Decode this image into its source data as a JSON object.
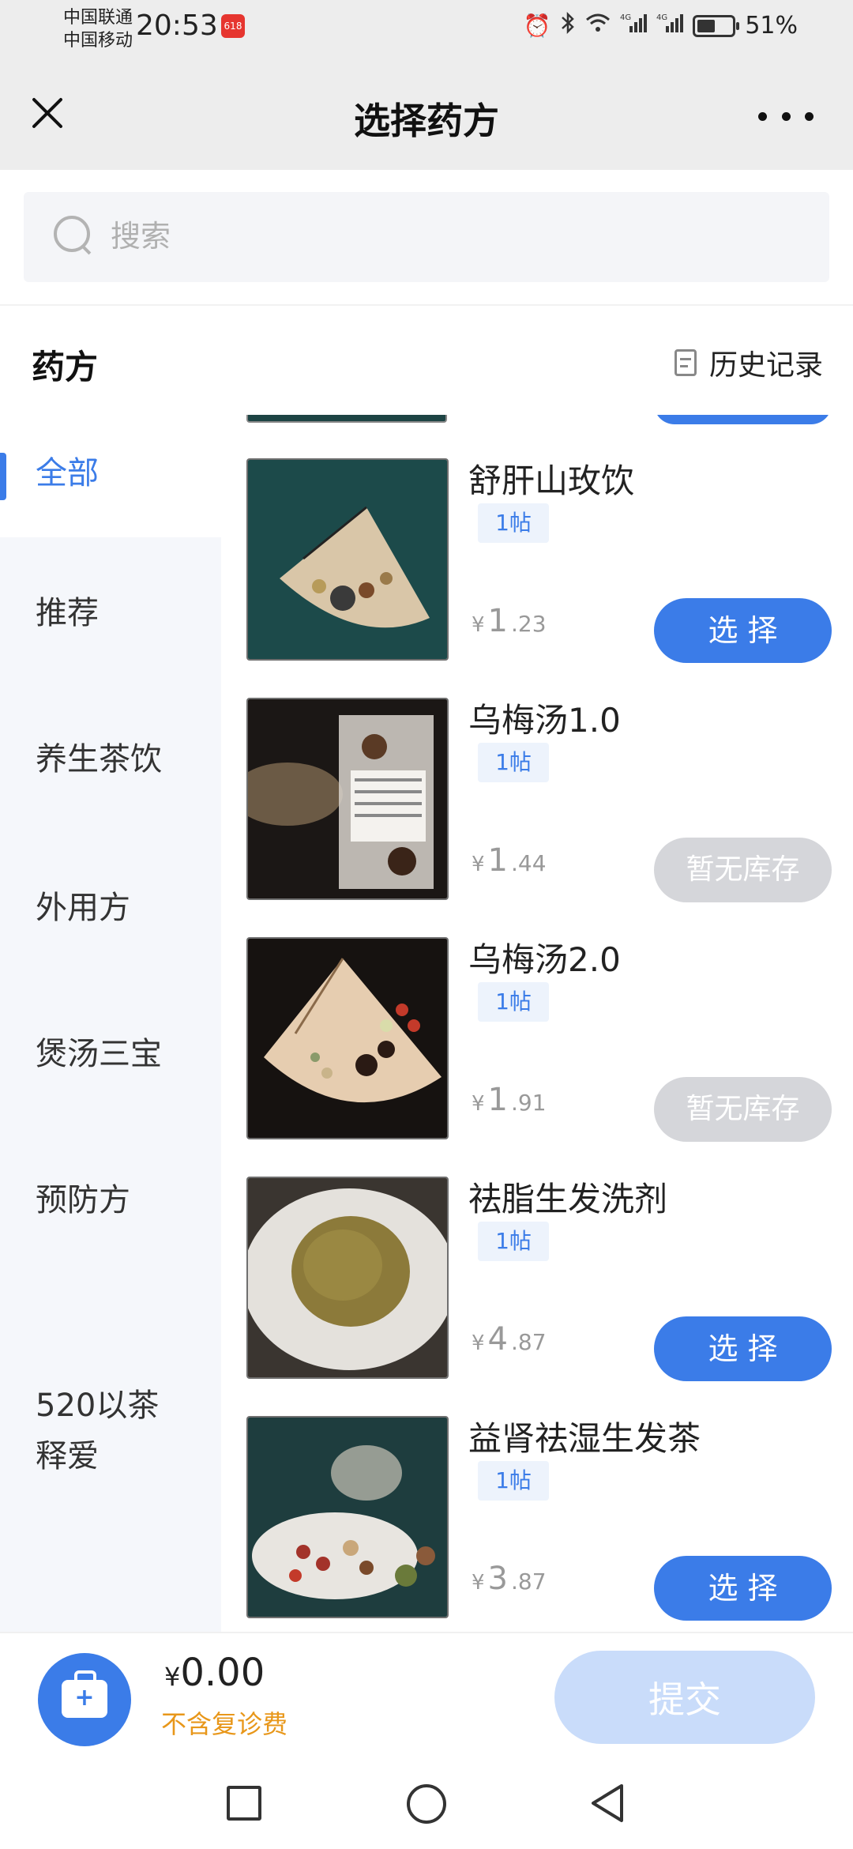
{
  "status_bar": {
    "carrier1": "中国联通",
    "carrier2": "中国移动",
    "time": "20:53",
    "badge": "618",
    "battery_percent": "51%",
    "battery_level": 0.51,
    "icons": [
      "alarm-icon",
      "bluetooth-icon",
      "wifi-icon",
      "signal-4g-icon",
      "signal-4g-icon",
      "battery-icon"
    ]
  },
  "nav": {
    "title": "选择药方"
  },
  "search": {
    "placeholder": "搜索"
  },
  "section": {
    "title": "药方",
    "history_label": "历史记录"
  },
  "sidebar": {
    "items": [
      {
        "label": "全部",
        "active": true
      },
      {
        "label": "推荐"
      },
      {
        "label": "养生茶饮"
      },
      {
        "label": "外用方"
      },
      {
        "label": "煲汤三宝"
      },
      {
        "label": "预防方"
      },
      {
        "label": "520以茶\n释爱"
      }
    ]
  },
  "products": [
    {
      "name": "舒肝山玫饮",
      "tag": "1帖",
      "currency": "¥",
      "price_int": "1",
      "price_dec": ".23",
      "action": "选 择",
      "in_stock": true
    },
    {
      "name": "乌梅汤1.0",
      "tag": "1帖",
      "currency": "¥",
      "price_int": "1",
      "price_dec": ".44",
      "action": "暂无库存",
      "in_stock": false
    },
    {
      "name": "乌梅汤2.0",
      "tag": "1帖",
      "currency": "¥",
      "price_int": "1",
      "price_dec": ".91",
      "action": "暂无库存",
      "in_stock": false
    },
    {
      "name": "祛脂生发洗剂",
      "tag": "1帖",
      "currency": "¥",
      "price_int": "4",
      "price_dec": ".87",
      "action": "选 择",
      "in_stock": true
    },
    {
      "name": "益肾祛湿生发茶",
      "tag": "1帖",
      "currency": "¥",
      "price_int": "3",
      "price_dec": ".87",
      "action": "选 择",
      "in_stock": true
    }
  ],
  "bottom": {
    "currency": "¥",
    "total": "0.00",
    "note": "不含复诊费",
    "submit_label": "提交"
  },
  "colors": {
    "accent": "#3b7ce8",
    "disabled": "#d5d6da",
    "note": "#e8971a"
  }
}
